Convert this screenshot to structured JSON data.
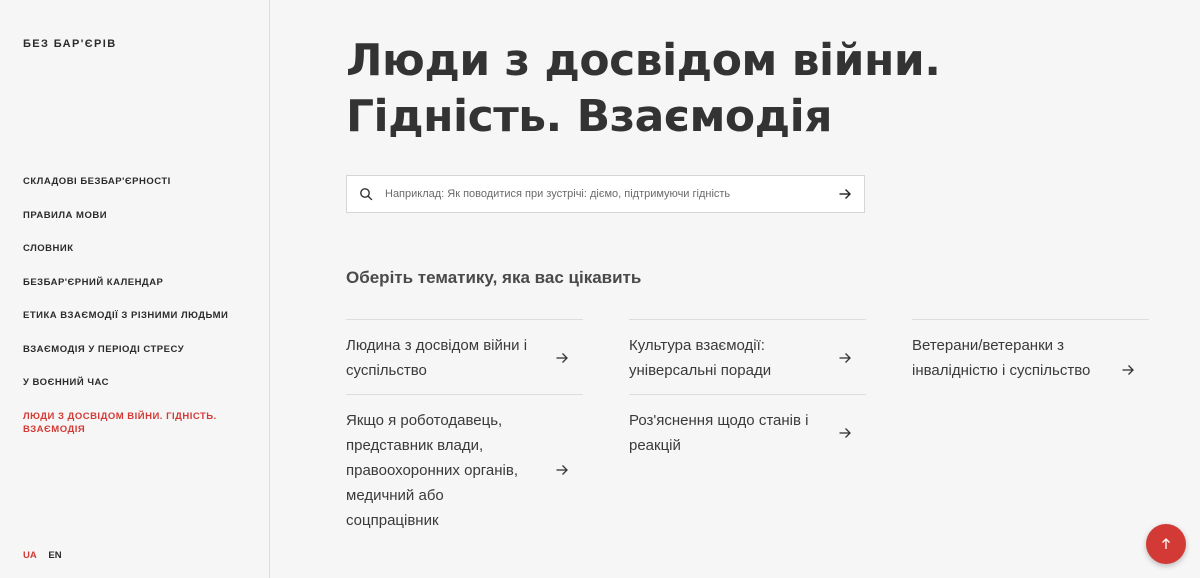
{
  "logo": "БЕЗ БАР'ЄРІВ",
  "sidebar": {
    "items": [
      {
        "label": "СКЛАДОВІ БЕЗБАР'ЄРНОСТІ"
      },
      {
        "label": "ПРАВИЛА МОВИ"
      },
      {
        "label": "СЛОВНИК"
      },
      {
        "label": "БЕЗБАР'ЄРНИЙ КАЛЕНДАР"
      },
      {
        "label": "ЕТИКА ВЗАЄМОДІЇ З РІЗНИМИ ЛЮДЬМИ"
      },
      {
        "label": "ВЗАЄМОДІЯ У ПЕРІОДІ СТРЕСУ"
      },
      {
        "label": "У ВОЄННИЙ ЧАС"
      },
      {
        "label": "ЛЮДИ З ДОСВІДОМ ВІЙНИ. ГІДНІСТЬ. ВЗАЄМОДІЯ",
        "active": true
      }
    ]
  },
  "languages": {
    "ua": "UA",
    "en": "EN",
    "active": "UA"
  },
  "main": {
    "title_line1": "Люди з досвідом війни.",
    "title_line2": "Гідність. Взаємодія",
    "search": {
      "placeholder": "Наприклад: Як поводитися при зустрічі: діємо, підтримуючи гідність"
    },
    "subheading": "Оберіть тематику, яка вас цікавить",
    "topics": [
      {
        "label": "Людина з досвідом війни і суспільство"
      },
      {
        "label": "Культура взаємодії: універсальні поради"
      },
      {
        "label": "Ветерани/ветеранки з інвалідністю і суспільство"
      },
      {
        "label": "Якщо я роботодавець, представник влади, правоохоронних органів, медичний або соцпрацівник"
      },
      {
        "label": "Роз'яснення щодо станів і реакцій"
      }
    ]
  },
  "icons": {
    "search": "search-icon",
    "arrow": "arrow-right-icon",
    "scroll_top": "arrow-up-icon"
  },
  "colors": {
    "accent": "#d33a35",
    "background": "#f6f6f6"
  }
}
